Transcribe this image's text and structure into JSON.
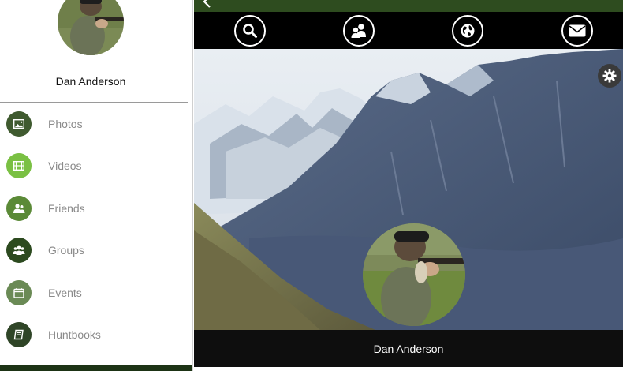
{
  "sidebar": {
    "user_name": "Dan Anderson",
    "items": [
      {
        "label": "Photos",
        "icon": "photo-icon",
        "color": "#3f5a2f"
      },
      {
        "label": "Videos",
        "icon": "film-icon",
        "color": "#7ac043"
      },
      {
        "label": "Friends",
        "icon": "friend-icon",
        "color": "#5b8a37"
      },
      {
        "label": "Groups",
        "icon": "group-icon",
        "color": "#2c4a1f"
      },
      {
        "label": "Events",
        "icon": "calendar-icon",
        "color": "#6a8a55"
      },
      {
        "label": "Huntbooks",
        "icon": "book-icon",
        "color": "#2f4527"
      }
    ]
  },
  "toolbar": {
    "buttons": [
      {
        "icon": "search-icon"
      },
      {
        "icon": "people-icon"
      },
      {
        "icon": "globe-icon"
      },
      {
        "icon": "envelope-icon"
      }
    ]
  },
  "profile": {
    "name": "Dan Anderson"
  },
  "colors": {
    "topbar": "#2e4c1f",
    "sidebar_bottom": "#1d3315",
    "name_bar": "#0e0e0e"
  }
}
